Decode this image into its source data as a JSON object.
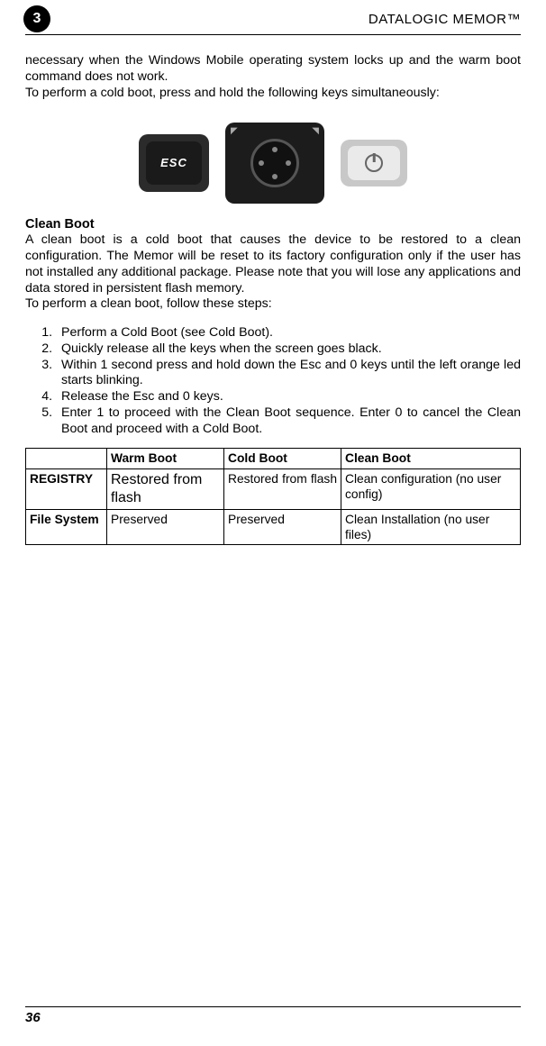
{
  "header": {
    "chapter": "3",
    "title": "DATALOGIC MEMOR™"
  },
  "intro": {
    "p1": "necessary when the Windows Mobile operating system locks up and the warm boot command does not work.",
    "p2": "To perform a cold boot, press and hold the following keys simultaneously:"
  },
  "keys": {
    "esc_label": "ESC",
    "esc_name": "esc-key",
    "nav_name": "navigation-pad",
    "power_name": "power-key"
  },
  "clean_boot": {
    "title": "Clean Boot",
    "p1": "A clean boot is a cold boot that causes the device to be restored to a clean configuration. The Memor will be reset to its factory configuration only if the user has not installed any additional package. Please note that you will lose any applications and data stored in persistent flash memory.",
    "p2": "To perform a clean boot, follow these steps:"
  },
  "steps": [
    "Perform a Cold Boot (see Cold Boot).",
    "Quickly release all the keys when the screen goes black.",
    "Within 1 second press and hold down the Esc and 0 keys until the left orange led starts blinking.",
    "Release the Esc and 0 keys.",
    "Enter 1 to proceed with the Clean Boot sequence. Enter 0 to cancel the Clean Boot and proceed with a Cold Boot."
  ],
  "table": {
    "headers": {
      "c1": "",
      "c2": "Warm Boot",
      "c3": "Cold Boot",
      "c4": "Clean Boot"
    },
    "rows": [
      {
        "label": "REGISTRY",
        "warm": "Restored from flash",
        "cold": "Restored from flash",
        "clean": "Clean configuration (no user config)"
      },
      {
        "label": "File System",
        "warm": "Preserved",
        "cold": "Preserved",
        "clean": "Clean Installation (no user files)"
      }
    ]
  },
  "footer": {
    "page": "36"
  }
}
